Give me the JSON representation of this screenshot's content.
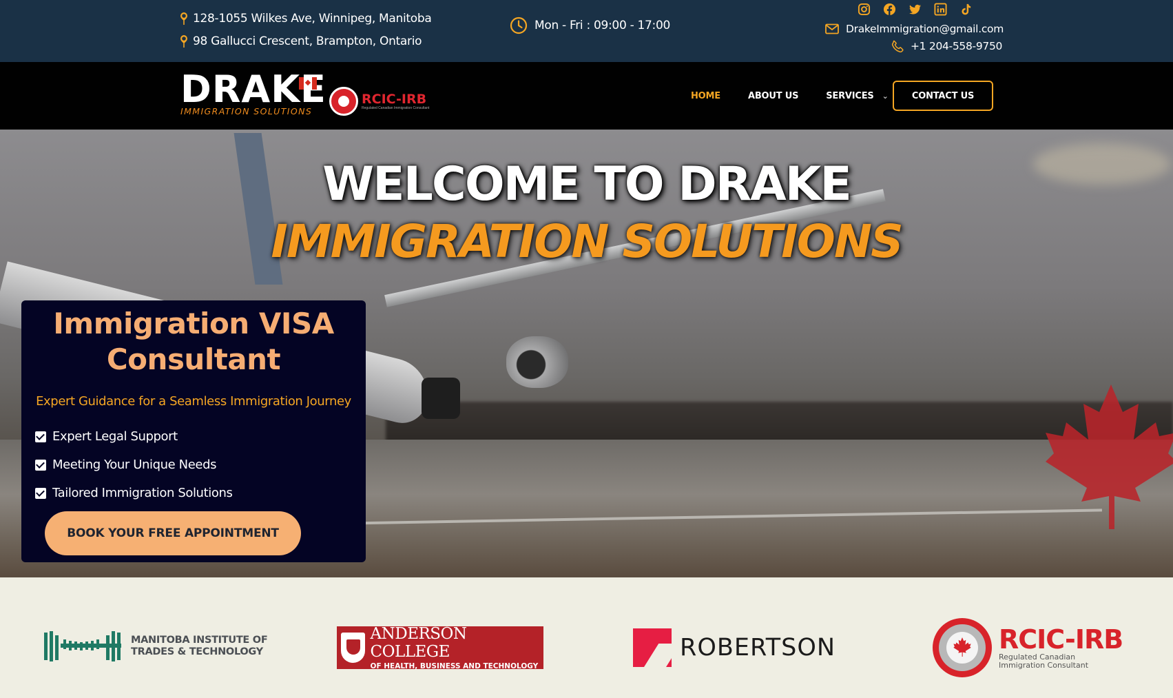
{
  "topbar": {
    "addresses": [
      "128-1055 Wilkes Ave, Winnipeg, Manitoba",
      "98 Gallucci Crescent, Brampton, Ontario"
    ],
    "hours": "Mon - Fri : 09:00 - 17:00",
    "email": "DrakeImmigration@gmail.com",
    "phone": "+1 204-558-9750",
    "social_icons": [
      "instagram-icon",
      "facebook-icon",
      "twitter-icon",
      "linkedin-icon",
      "tiktok-icon"
    ]
  },
  "brand": {
    "logo_word": "DRAKE",
    "logo_sub": "IMMIGRATION SOLUTIONS",
    "badge_title": "RCIC-IRB",
    "badge_sub": "Regulated Canadian Immigration Consultant"
  },
  "nav": {
    "items": [
      "HOME",
      "ABOUT US",
      "SERVICES"
    ],
    "contact_label": "CONTACT US"
  },
  "hero": {
    "title_line1": "WELCOME TO DRAKE",
    "title_line2": "IMMIGRATION SOLUTIONS",
    "card": {
      "heading_line1": "Immigration VISA",
      "heading_line2": "Consultant",
      "tagline": "Expert Guidance for a Seamless Immigration Journey",
      "checks": [
        "Expert Legal Support",
        "Meeting Your Unique Needs",
        "Tailored Immigration Solutions"
      ],
      "cta_label": "BOOK YOUR FREE APPOINTMENT"
    }
  },
  "partners": {
    "mitt_line1": "MANITOBA INSTITUTE OF",
    "mitt_line2": "TRADES & TECHNOLOGY",
    "anderson_line1": "ANDERSON COLLEGE",
    "anderson_line2": "OF HEALTH, BUSINESS AND TECHNOLOGY",
    "robertson": "ROBERTSON",
    "rcic_title": "RCIC-IRB",
    "rcic_line1": "Regulated Canadian",
    "rcic_line2": "Immigration Consultant"
  },
  "colors": {
    "topbar_bg": "#1a3146",
    "nav_bg": "#010101",
    "accent_orange": "#f5a623",
    "card_bg": "#040424",
    "cta_bg": "#f6b073",
    "partners_bg": "#efeee3"
  }
}
